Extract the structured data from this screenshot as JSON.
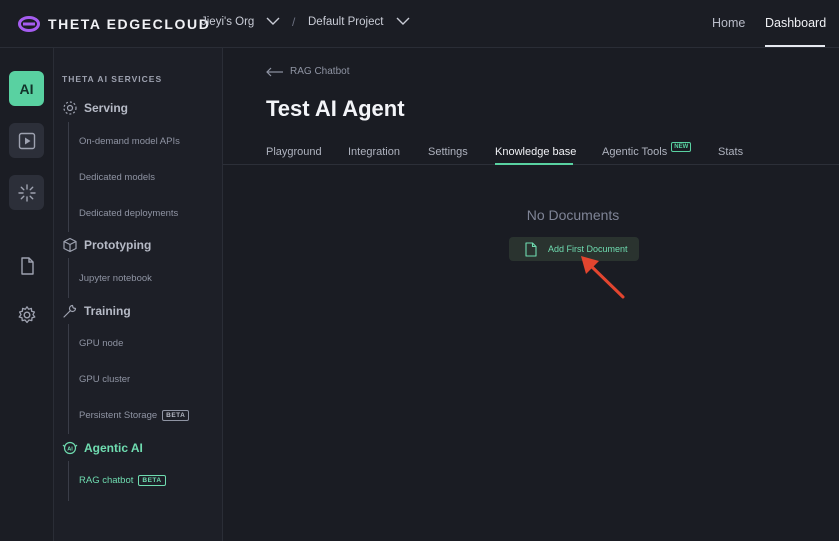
{
  "header": {
    "logo_text": "THETA EDGECLOUD",
    "org": "Jieyi's Org",
    "separator": "/",
    "project": "Default Project",
    "nav": [
      {
        "label": "Home",
        "active": false
      },
      {
        "label": "Dashboard",
        "active": true
      }
    ]
  },
  "rail": {
    "ai_label": "AI",
    "icons": [
      "play-icon",
      "sparkle-icon",
      "document-icon",
      "gear-icon"
    ]
  },
  "sidebar": {
    "heading": "THETA AI SERVICES",
    "sections": [
      {
        "title": "Serving",
        "icon": "serving-icon",
        "items": [
          {
            "label": "On-demand model APIs"
          },
          {
            "label": "Dedicated models"
          },
          {
            "label": "Dedicated deployments"
          }
        ]
      },
      {
        "title": "Prototyping",
        "icon": "cube-icon",
        "items": [
          {
            "label": "Jupyter notebook"
          }
        ]
      },
      {
        "title": "Training",
        "icon": "wrench-icon",
        "items": [
          {
            "label": "GPU node"
          },
          {
            "label": "GPU cluster"
          },
          {
            "label": "Persistent Storage",
            "badge": "BETA"
          }
        ]
      },
      {
        "title": "Agentic AI",
        "icon": "agentic-ai-icon",
        "active": true,
        "items": [
          {
            "label": "RAG chatbot",
            "badge": "BETA",
            "active": true
          }
        ]
      }
    ]
  },
  "main": {
    "back_label": "RAG Chatbot",
    "title": "Test AI Agent",
    "tabs": [
      {
        "label": "Playground"
      },
      {
        "label": "Integration"
      },
      {
        "label": "Settings"
      },
      {
        "label": "Knowledge base",
        "active": true
      },
      {
        "label": "Agentic Tools",
        "badge": "NEW"
      },
      {
        "label": "Stats"
      }
    ],
    "empty_title": "No Documents",
    "add_button_label": "Add First Document"
  },
  "colors": {
    "accent": "#59d1a1",
    "background": "#1a1c23",
    "arrow": "#e2452f",
    "logo": "#a55cf0"
  }
}
